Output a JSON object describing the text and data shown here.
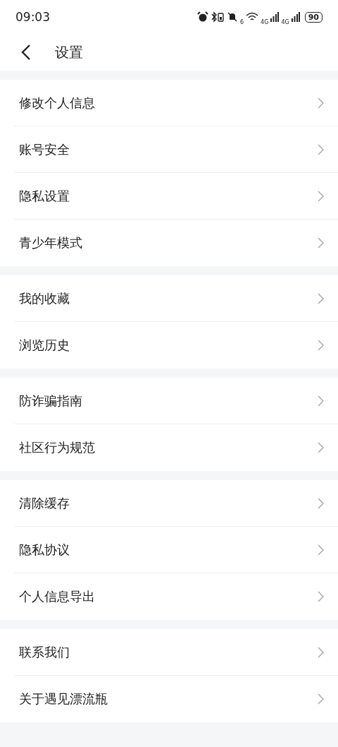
{
  "status_bar": {
    "time": "09:03",
    "wifi_label": "6",
    "signal_labels": [
      "4G",
      "4G"
    ],
    "battery": "90"
  },
  "header": {
    "title": "设置"
  },
  "groups": [
    {
      "items": [
        {
          "label": "修改个人信息"
        },
        {
          "label": "账号安全"
        },
        {
          "label": "隐私设置"
        },
        {
          "label": "青少年模式"
        }
      ]
    },
    {
      "items": [
        {
          "label": "我的收藏"
        },
        {
          "label": "浏览历史"
        }
      ]
    },
    {
      "items": [
        {
          "label": "防诈骗指南"
        },
        {
          "label": "社区行为规范"
        }
      ]
    },
    {
      "items": [
        {
          "label": "清除缓存"
        },
        {
          "label": "隐私协议"
        },
        {
          "label": "个人信息导出"
        }
      ]
    },
    {
      "items": [
        {
          "label": "联系我们"
        },
        {
          "label": "关于遇见漂流瓶"
        }
      ]
    }
  ]
}
